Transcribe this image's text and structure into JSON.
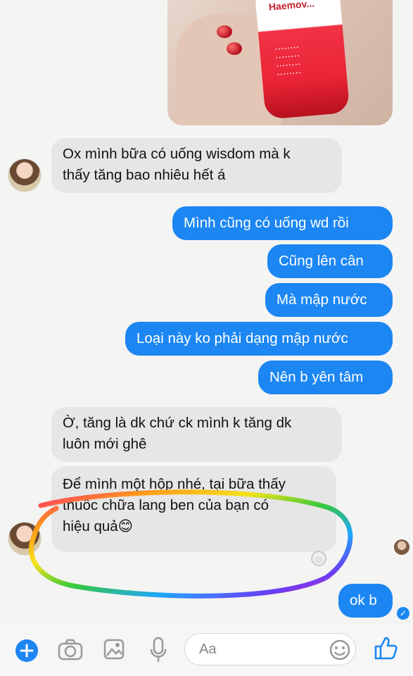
{
  "header_photo": {
    "brand_text": "Haemov..."
  },
  "messages": [
    {
      "id": "m1",
      "side": "in",
      "text_lines": [
        "Ox mình bữa có uống wisdom mà k",
        "thấy tăng bao nhiêu hết á"
      ]
    },
    {
      "id": "m2",
      "side": "out",
      "text": "Mình cũng có uống wd rồi"
    },
    {
      "id": "m3",
      "side": "out",
      "text": "Cũng lên cân"
    },
    {
      "id": "m4",
      "side": "out",
      "text": "Mà mập nước"
    },
    {
      "id": "m5",
      "side": "out",
      "text": "Loại này ko phải dạng mập nước"
    },
    {
      "id": "m6",
      "side": "out",
      "text": "Nên b yên tâm"
    },
    {
      "id": "m7",
      "side": "in",
      "text_lines": [
        "Ờ, tăng là dk chứ ck mình k tăng dk",
        "luôn mới ghê"
      ]
    },
    {
      "id": "m8",
      "side": "in",
      "text_lines": [
        "Để mình một hộp nhé, tại bữa thấy",
        "thuốc chữa lang ben của bạn có",
        "hiệu quả😊"
      ]
    },
    {
      "id": "m9",
      "side": "out",
      "text": "ok b"
    }
  ],
  "composer": {
    "placeholder": "Aa",
    "icons": [
      "plus-icon",
      "camera-icon",
      "image-icon",
      "microphone-icon",
      "emoji-icon",
      "thumbs-up-icon"
    ]
  },
  "colors": {
    "outgoing_bubble": "#1c86f2",
    "incoming_bubble": "#e6e6e6",
    "accent": "#1c86f2"
  }
}
